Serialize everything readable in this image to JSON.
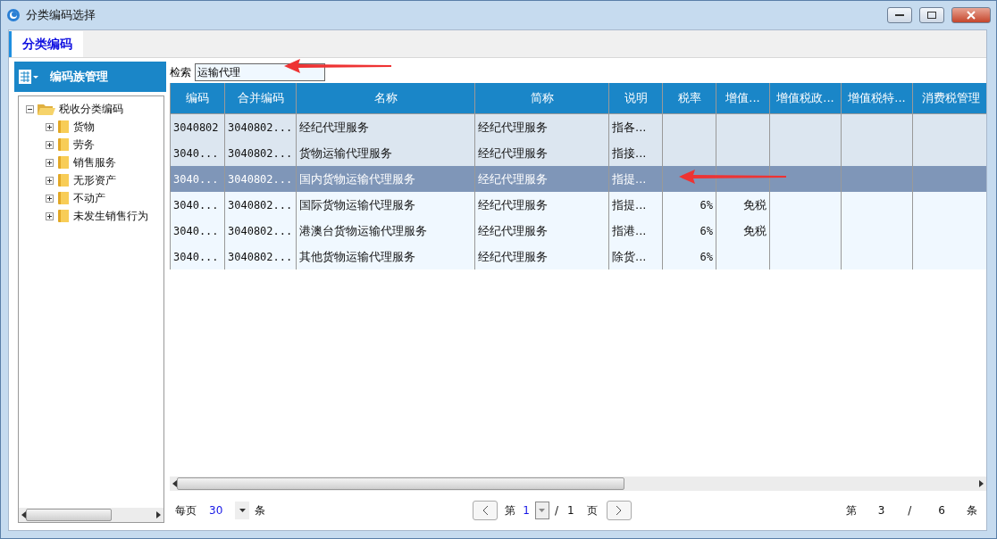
{
  "window": {
    "title": "分类编码选择"
  },
  "tabs": [
    {
      "label": "分类编码",
      "selected": true
    }
  ],
  "sidebar": {
    "title": "编码族管理",
    "tree": [
      {
        "label": "税收分类编码",
        "expanded": true,
        "children": [
          {
            "label": "货物",
            "expanded": false
          },
          {
            "label": "劳务",
            "expanded": false
          },
          {
            "label": "销售服务",
            "expanded": false
          },
          {
            "label": "无形资产",
            "expanded": false
          },
          {
            "label": "不动产",
            "expanded": false
          },
          {
            "label": "未发生销售行为",
            "expanded": false
          }
        ]
      }
    ]
  },
  "search": {
    "label": "检索",
    "value": "运输代理"
  },
  "table": {
    "columns": [
      "编码",
      "合并编码",
      "名称",
      "简称",
      "说明",
      "税率",
      "增值...",
      "增值税政...",
      "增值税特...",
      "消费税管理"
    ],
    "rows": [
      {
        "selected": false,
        "highlighted": true,
        "cells": [
          "3040802",
          "3040802...",
          "经纪代理服务",
          "经纪代理服务",
          "指各...",
          "",
          "",
          "",
          "",
          ""
        ]
      },
      {
        "selected": false,
        "highlighted": true,
        "cells": [
          "3040...",
          "3040802...",
          "货物运输代理服务",
          "经纪代理服务",
          "指接...",
          "",
          "",
          "",
          "",
          ""
        ]
      },
      {
        "selected": true,
        "highlighted": false,
        "cells": [
          "3040...",
          "3040802...",
          "国内货物运输代理服务",
          "经纪代理服务",
          "指提...",
          "",
          "",
          "",
          "",
          ""
        ]
      },
      {
        "selected": false,
        "highlighted": false,
        "cells": [
          "3040...",
          "3040802...",
          "国际货物运输代理服务",
          "经纪代理服务",
          "指提...",
          "6%",
          "免税",
          "",
          "",
          ""
        ]
      },
      {
        "selected": false,
        "highlighted": false,
        "cells": [
          "3040...",
          "3040802...",
          "港澳台货物运输代理服务",
          "经纪代理服务",
          "指港...",
          "6%",
          "免税",
          "",
          "",
          ""
        ]
      },
      {
        "selected": false,
        "highlighted": false,
        "cells": [
          "3040...",
          "3040802...",
          "其他货物运输代理服务",
          "经纪代理服务",
          "除货...",
          "6%",
          "",
          "",
          "",
          ""
        ]
      }
    ]
  },
  "pager": {
    "per_page_label": "每页",
    "per_page": "30",
    "per_page_unit": "条",
    "page_prefix": "第",
    "page": "1",
    "page_sep": "/",
    "page_total": "1",
    "page_unit": "页",
    "record_prefix": "第",
    "record": "3",
    "record_sep": "/",
    "record_total": "6",
    "record_unit": "条"
  }
}
